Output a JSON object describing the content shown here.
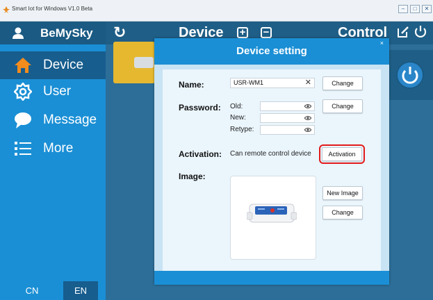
{
  "window": {
    "title": "Smart Iot for Windows V1.0 Beta",
    "controls": [
      "minimize",
      "maximize",
      "close"
    ]
  },
  "header": {
    "brand": "BeMySky",
    "center_title": "Device",
    "right_title": "Control",
    "icons": [
      "refresh-icon",
      "add-icon",
      "remove-icon",
      "edit-icon",
      "power-icon"
    ]
  },
  "sidebar": {
    "items": [
      {
        "label": "Device",
        "icon": "home-icon",
        "active": true
      },
      {
        "label": "User",
        "icon": "gear-icon",
        "active": false
      },
      {
        "label": "Message",
        "icon": "chat-icon",
        "active": false
      },
      {
        "label": "More",
        "icon": "list-icon",
        "active": false
      }
    ],
    "languages": {
      "cn": "CN",
      "en": "EN",
      "selected": "EN"
    }
  },
  "dialog": {
    "title": "Device setting",
    "close_glyph": "×",
    "name": {
      "label": "Name:",
      "value": "USR-WM1",
      "clear_glyph": "✕",
      "button": "Change"
    },
    "password": {
      "label": "Password:",
      "old_label": "Old:",
      "new_label": "New:",
      "retype_label": "Retype:",
      "button": "Change"
    },
    "activation": {
      "label": "Activation:",
      "status": "Can remote control device",
      "button": "Activation"
    },
    "image": {
      "label": "Image:",
      "new_button": "New Image",
      "change_button": "Change"
    }
  },
  "colors": {
    "sidebar": "#1a8fd5",
    "header": "#1f5e86",
    "accent_highlight": "#e31b1b"
  }
}
